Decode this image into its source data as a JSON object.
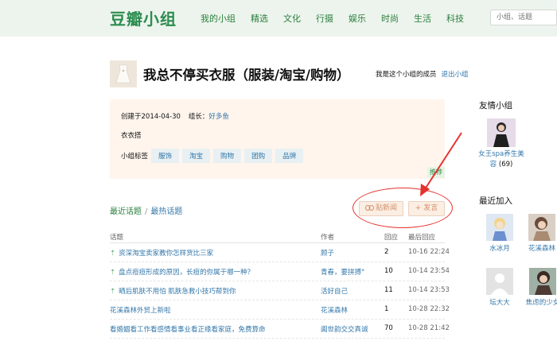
{
  "header": {
    "logo": "豆瓣小组",
    "nav": [
      "我的小组",
      "精选",
      "文化",
      "行摄",
      "娱乐",
      "时尚",
      "生活",
      "科技"
    ],
    "search_placeholder": "小组、话题"
  },
  "group": {
    "title": "我总不停买衣服（服装/淘宝/购物）",
    "member_text": "我是这个小组的成员",
    "leave_link": "退出小组",
    "created": "创建于2014-04-30",
    "leader_label": "组长：",
    "leader_name": "好多鱼",
    "description": "衣衣搭",
    "tags_label": "小组标签",
    "tags": [
      "服饰",
      "淘宝",
      "购物",
      "团购",
      "品牌"
    ],
    "recommend": "推荐"
  },
  "topics": {
    "tab_latest": "最近话题",
    "separator": "/",
    "tab_hot": "最热话题",
    "btn_paste": "贴新闻",
    "btn_post": "+ 发言",
    "columns": {
      "title": "话题",
      "author": "作者",
      "reply": "回应",
      "time": "最后回应"
    },
    "rows": [
      {
        "pinned": true,
        "title": "资深淘宝卖家教你怎样货比三家",
        "author": "顾子",
        "reply": "2",
        "time": "10-16 22:24"
      },
      {
        "pinned": true,
        "title": "盘点痘痘形成的原因，长痘的你属于哪一种？",
        "author": "青春，要拼搏°",
        "reply": "10",
        "time": "10-14 23:54"
      },
      {
        "pinned": true,
        "title": "晒后肌肤不用怕 肌肤急救小技巧帮到你",
        "author": "活好自己",
        "reply": "11",
        "time": "10-14 23:53"
      },
      {
        "pinned": false,
        "title": "花溪森林外贸上新啦",
        "author": "花溪森林",
        "reply": "1",
        "time": "10-28 22:32"
      },
      {
        "pinned": false,
        "title": "看婚姻看工作看感情看事业看正缘看家庭，免费算命",
        "author": "阖世韵交交真诚",
        "reply": "70",
        "time": "10-28 21:42"
      }
    ]
  },
  "sidebar": {
    "friends_heading": "友情小组",
    "friend": {
      "name": "女王spa养生美容",
      "count": "(69)"
    },
    "recent_heading": "最近加入",
    "users": [
      "水冰月",
      "花溪森林",
      "坛大大",
      "焦虑的少女"
    ]
  },
  "colors": {
    "accent_green": "#2a7f3d",
    "link_blue": "#3377aa",
    "annotation_red": "#e5322d"
  },
  "icons": {
    "pin": "pin-icon",
    "paste": "link-icon"
  }
}
